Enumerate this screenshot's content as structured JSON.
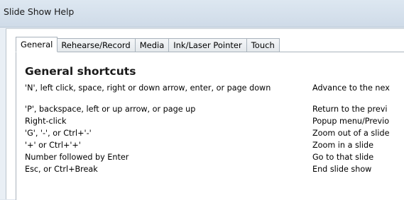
{
  "window": {
    "title": "Slide Show Help"
  },
  "tabs": [
    {
      "label": "General",
      "active": true
    },
    {
      "label": "Rehearse/Record",
      "active": false
    },
    {
      "label": "Media",
      "active": false
    },
    {
      "label": "Ink/Laser Pointer",
      "active": false
    },
    {
      "label": "Touch",
      "active": false
    }
  ],
  "content": {
    "heading": "General shortcuts",
    "shortcuts": [
      {
        "keys": "'N', left click, space, right or down arrow, enter, or page down",
        "action": "Advance to the nex"
      },
      {
        "keys": "'P', backspace, left or up arrow, or page up",
        "action": "Return to the previ"
      },
      {
        "keys": "Right-click",
        "action": "Popup menu/Previo"
      },
      {
        "keys": "'G', '-', or Ctrl+'-'",
        "action": "Zoom out of a slide"
      },
      {
        "keys": "'+' or Ctrl+'+'",
        "action": "Zoom in a slide"
      },
      {
        "keys": "Number followed by Enter",
        "action": "Go to that slide"
      },
      {
        "keys": "Esc, or Ctrl+Break",
        "action": "End slide show"
      }
    ]
  }
}
